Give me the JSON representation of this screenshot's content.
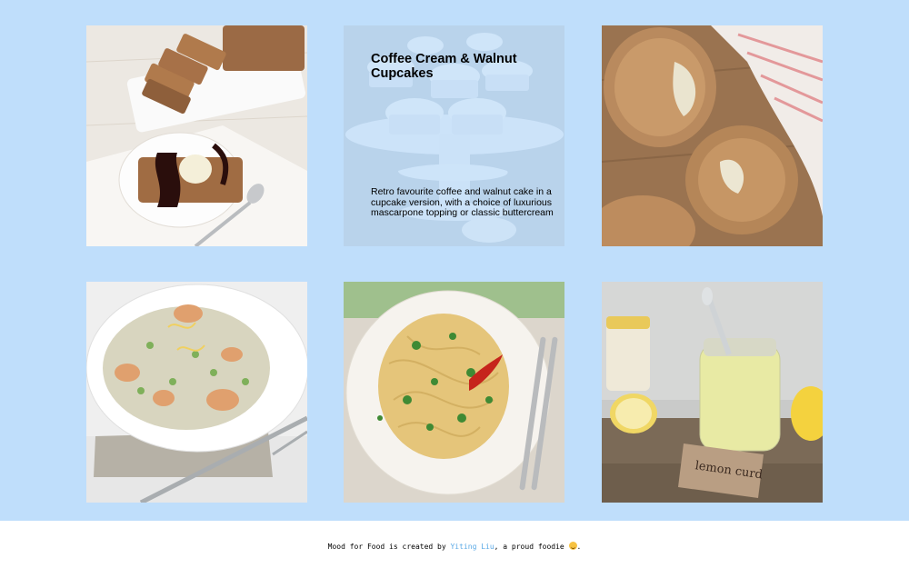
{
  "gallery": {
    "cards": [
      {
        "name": "Banana bread with ice cream and chocolate sauce"
      },
      {
        "name": "Coffee cream and walnut cupcakes",
        "title": "Coffee Cream & Walnut Cupcakes",
        "description": "Retro favourite coffee and walnut cake in a cupcake version, with a choice of luxurious mascarpone topping or classic buttercream"
      },
      {
        "name": "Cheese stuffed bread rolls"
      },
      {
        "name": "Prawn and pea risotto"
      },
      {
        "name": "Spaghetti with chilli and parsley"
      },
      {
        "name": "Jar of lemon curd",
        "tag_text": "lemon curd"
      }
    ]
  },
  "footer": {
    "prefix": "Mood for Food is created by ",
    "author_link": "Yiting Liu",
    "suffix": ", a proud foodie",
    "end": "."
  },
  "colors": {
    "background": "#bfdefb",
    "link": "#5aa9e6"
  }
}
